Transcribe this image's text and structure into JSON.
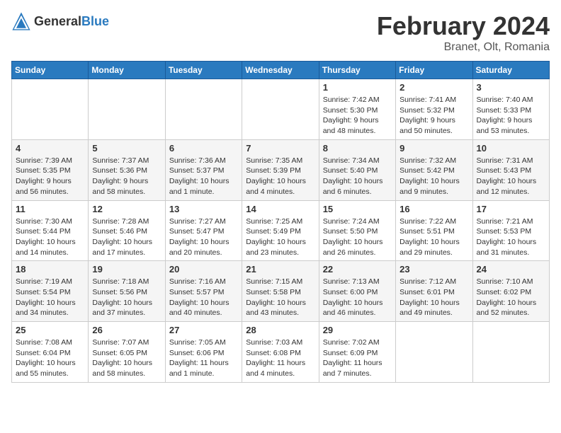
{
  "header": {
    "logo_general": "General",
    "logo_blue": "Blue",
    "month_title": "February 2024",
    "location": "Branet, Olt, Romania"
  },
  "weekdays": [
    "Sunday",
    "Monday",
    "Tuesday",
    "Wednesday",
    "Thursday",
    "Friday",
    "Saturday"
  ],
  "weeks": [
    [
      {
        "day": "",
        "info": ""
      },
      {
        "day": "",
        "info": ""
      },
      {
        "day": "",
        "info": ""
      },
      {
        "day": "",
        "info": ""
      },
      {
        "day": "1",
        "info": "Sunrise: 7:42 AM\nSunset: 5:30 PM\nDaylight: 9 hours\nand 48 minutes."
      },
      {
        "day": "2",
        "info": "Sunrise: 7:41 AM\nSunset: 5:32 PM\nDaylight: 9 hours\nand 50 minutes."
      },
      {
        "day": "3",
        "info": "Sunrise: 7:40 AM\nSunset: 5:33 PM\nDaylight: 9 hours\nand 53 minutes."
      }
    ],
    [
      {
        "day": "4",
        "info": "Sunrise: 7:39 AM\nSunset: 5:35 PM\nDaylight: 9 hours\nand 56 minutes."
      },
      {
        "day": "5",
        "info": "Sunrise: 7:37 AM\nSunset: 5:36 PM\nDaylight: 9 hours\nand 58 minutes."
      },
      {
        "day": "6",
        "info": "Sunrise: 7:36 AM\nSunset: 5:37 PM\nDaylight: 10 hours\nand 1 minute."
      },
      {
        "day": "7",
        "info": "Sunrise: 7:35 AM\nSunset: 5:39 PM\nDaylight: 10 hours\nand 4 minutes."
      },
      {
        "day": "8",
        "info": "Sunrise: 7:34 AM\nSunset: 5:40 PM\nDaylight: 10 hours\nand 6 minutes."
      },
      {
        "day": "9",
        "info": "Sunrise: 7:32 AM\nSunset: 5:42 PM\nDaylight: 10 hours\nand 9 minutes."
      },
      {
        "day": "10",
        "info": "Sunrise: 7:31 AM\nSunset: 5:43 PM\nDaylight: 10 hours\nand 12 minutes."
      }
    ],
    [
      {
        "day": "11",
        "info": "Sunrise: 7:30 AM\nSunset: 5:44 PM\nDaylight: 10 hours\nand 14 minutes."
      },
      {
        "day": "12",
        "info": "Sunrise: 7:28 AM\nSunset: 5:46 PM\nDaylight: 10 hours\nand 17 minutes."
      },
      {
        "day": "13",
        "info": "Sunrise: 7:27 AM\nSunset: 5:47 PM\nDaylight: 10 hours\nand 20 minutes."
      },
      {
        "day": "14",
        "info": "Sunrise: 7:25 AM\nSunset: 5:49 PM\nDaylight: 10 hours\nand 23 minutes."
      },
      {
        "day": "15",
        "info": "Sunrise: 7:24 AM\nSunset: 5:50 PM\nDaylight: 10 hours\nand 26 minutes."
      },
      {
        "day": "16",
        "info": "Sunrise: 7:22 AM\nSunset: 5:51 PM\nDaylight: 10 hours\nand 29 minutes."
      },
      {
        "day": "17",
        "info": "Sunrise: 7:21 AM\nSunset: 5:53 PM\nDaylight: 10 hours\nand 31 minutes."
      }
    ],
    [
      {
        "day": "18",
        "info": "Sunrise: 7:19 AM\nSunset: 5:54 PM\nDaylight: 10 hours\nand 34 minutes."
      },
      {
        "day": "19",
        "info": "Sunrise: 7:18 AM\nSunset: 5:56 PM\nDaylight: 10 hours\nand 37 minutes."
      },
      {
        "day": "20",
        "info": "Sunrise: 7:16 AM\nSunset: 5:57 PM\nDaylight: 10 hours\nand 40 minutes."
      },
      {
        "day": "21",
        "info": "Sunrise: 7:15 AM\nSunset: 5:58 PM\nDaylight: 10 hours\nand 43 minutes."
      },
      {
        "day": "22",
        "info": "Sunrise: 7:13 AM\nSunset: 6:00 PM\nDaylight: 10 hours\nand 46 minutes."
      },
      {
        "day": "23",
        "info": "Sunrise: 7:12 AM\nSunset: 6:01 PM\nDaylight: 10 hours\nand 49 minutes."
      },
      {
        "day": "24",
        "info": "Sunrise: 7:10 AM\nSunset: 6:02 PM\nDaylight: 10 hours\nand 52 minutes."
      }
    ],
    [
      {
        "day": "25",
        "info": "Sunrise: 7:08 AM\nSunset: 6:04 PM\nDaylight: 10 hours\nand 55 minutes."
      },
      {
        "day": "26",
        "info": "Sunrise: 7:07 AM\nSunset: 6:05 PM\nDaylight: 10 hours\nand 58 minutes."
      },
      {
        "day": "27",
        "info": "Sunrise: 7:05 AM\nSunset: 6:06 PM\nDaylight: 11 hours\nand 1 minute."
      },
      {
        "day": "28",
        "info": "Sunrise: 7:03 AM\nSunset: 6:08 PM\nDaylight: 11 hours\nand 4 minutes."
      },
      {
        "day": "29",
        "info": "Sunrise: 7:02 AM\nSunset: 6:09 PM\nDaylight: 11 hours\nand 7 minutes."
      },
      {
        "day": "",
        "info": ""
      },
      {
        "day": "",
        "info": ""
      }
    ]
  ]
}
